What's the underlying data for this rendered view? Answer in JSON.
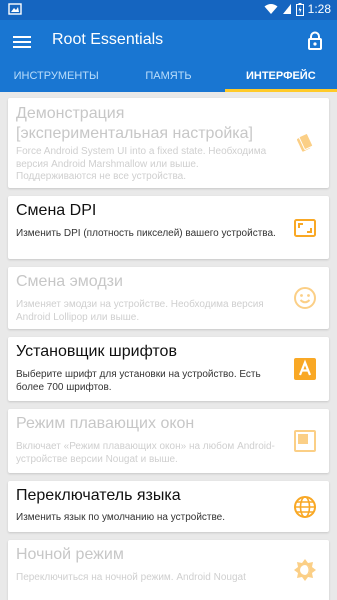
{
  "status_bar": {
    "time": "1:28"
  },
  "app_bar": {
    "title": "Root Essentials"
  },
  "tabs": [
    {
      "label": "ИНСТРУМЕНТЫ",
      "active": false
    },
    {
      "label": "ПАМЯТЬ",
      "active": false
    },
    {
      "label": "ИНТЕРФЕЙС",
      "active": true
    }
  ],
  "cards": [
    {
      "title": "Демонстрация [экспериментальная настройка]",
      "description": "Force Android System UI into a fixed state. Необходима версия Android Marshmallow или выше. Поддерживаются не все устройства.",
      "icon": "cards-icon",
      "enabled": false
    },
    {
      "title": "Смена DPI",
      "description": "Изменить DPI (плотность пикселей) вашего устройства.",
      "icon": "aspect-ratio-icon",
      "enabled": true
    },
    {
      "title": "Смена эмодзи",
      "description": "Изменяет эмодзи на устройстве. Необходима версия Android Lollipop или выше.",
      "icon": "smiley-icon",
      "enabled": false
    },
    {
      "title": "Установщик шрифтов",
      "description": "Выберите шрифт для установки на устройство. Есть более 700 шрифтов.",
      "icon": "font-icon",
      "enabled": true
    },
    {
      "title": "Режим плавающих окон",
      "description": "Включает «Режим плавающих окон» на любом Android-устройстве версии Nougat и выше.",
      "icon": "floating-window-icon",
      "enabled": false
    },
    {
      "title": "Переключатель языка",
      "description": "Изменить язык по умолчанию на устройстве.",
      "icon": "globe-icon",
      "enabled": true
    },
    {
      "title": "Ночной режим",
      "description": "Переключиться на ночной режим. Android Nougat",
      "icon": "brightness-icon",
      "enabled": false
    }
  ],
  "colors": {
    "primary": "#1976d2",
    "primary_dark": "#1565c0",
    "tab_indicator": "#ffca28",
    "icon_accent": "#f9a825"
  }
}
